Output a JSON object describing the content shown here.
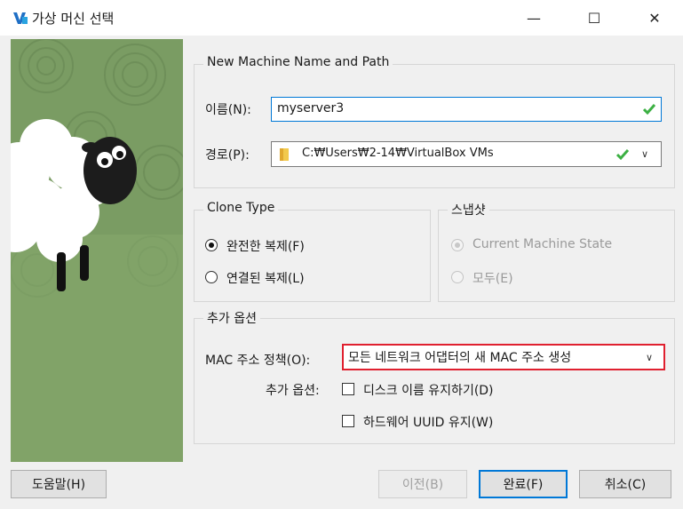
{
  "window": {
    "title": "가상 머신 선택",
    "minimize_glyph": "—",
    "maximize_glyph": "☐",
    "close_glyph": "✕"
  },
  "name_path": {
    "legend": "New Machine Name and Path",
    "name_label": "이름(N):",
    "name_value": "myserver3",
    "path_label": "경로(P):",
    "path_value": "C:₩Users₩2-14₩VirtualBox VMs"
  },
  "clone_type": {
    "legend": "Clone Type",
    "options": [
      {
        "label": "완전한 복제(F)",
        "checked": true
      },
      {
        "label": "연결된 복제(L)",
        "checked": false
      }
    ]
  },
  "snapshot": {
    "legend": "스냅샷",
    "options": [
      {
        "label": "Current Machine State",
        "checked": true,
        "enabled": false
      },
      {
        "label": "모두(E)",
        "checked": false,
        "enabled": false
      }
    ]
  },
  "extra": {
    "legend": "추가 옵션",
    "mac_label": "MAC 주소 정책(O):",
    "mac_value": "모든 네트워크 어댑터의 새 MAC 주소 생성",
    "options_label": "추가 옵션:",
    "keep_disk_names": "디스크 이름 유지하기(D)",
    "keep_uuid": "하드웨어 UUID 유지(W)"
  },
  "buttons": {
    "help": "도움말(H)",
    "back": "이전(B)",
    "finish": "완료(F)",
    "cancel": "취소(C)"
  },
  "colors": {
    "accent": "#0078d7",
    "highlight": "#e0202f",
    "ok_check": "#3cb043",
    "art_green": "#7a9c63"
  }
}
